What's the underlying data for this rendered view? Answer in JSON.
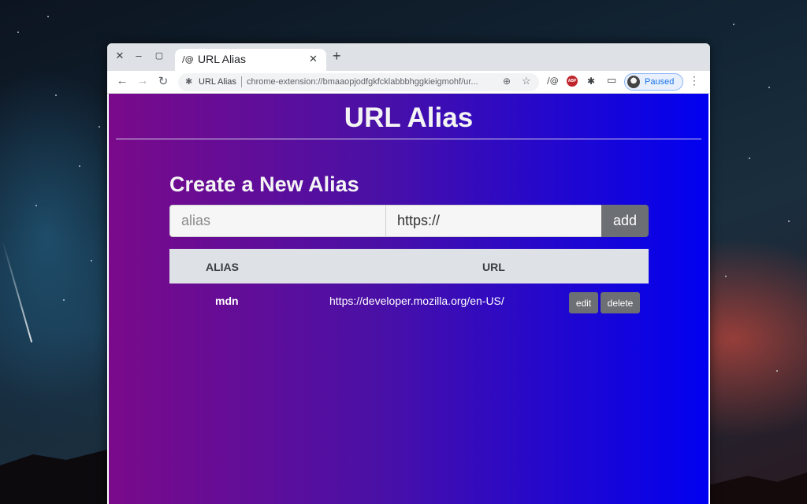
{
  "window": {
    "tab_title": "URL Alias",
    "tab_favicon": "/@",
    "close_glyph": "✕",
    "minimize_glyph": "–",
    "maximize_glyph": "▢",
    "new_tab_glyph": "+",
    "tab_close_glyph": "✕"
  },
  "toolbar": {
    "back_glyph": "←",
    "forward_glyph": "→",
    "reload_glyph": "↻",
    "omnibox": {
      "site_name": "URL Alias",
      "url": "chrome-extension://bmaaopjodfgkfcklabbbhggkieigmohf/ur..."
    },
    "extensions": {
      "url_alias_icon": "/@",
      "abp_label": "ABP",
      "puzzle_glyph": "✱",
      "cast_glyph": "▭"
    },
    "profile_label": "Paused",
    "menu_glyph": "⋮",
    "zoom_glyph": "⊕",
    "star_glyph": "☆"
  },
  "page": {
    "title": "URL Alias",
    "section_heading": "Create a New Alias",
    "form": {
      "alias_placeholder": "alias",
      "alias_value": "",
      "url_value": "https://",
      "add_label": "add"
    },
    "table": {
      "columns": [
        "ALIAS",
        "URL"
      ],
      "rows": [
        {
          "alias": "mdn",
          "url": "https://developer.mozilla.org/en-US/",
          "edit_label": "edit",
          "delete_label": "delete"
        }
      ]
    }
  }
}
